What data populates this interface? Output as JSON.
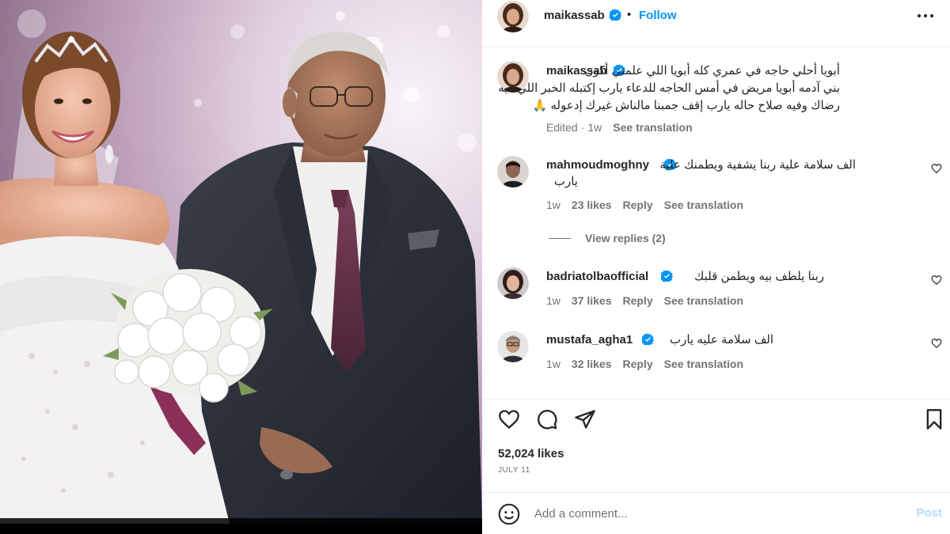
{
  "post": {
    "username": "maikassab",
    "follow_label": "Follow",
    "separator": "•",
    "caption_lines": [
      "أبويا أحلي حاجه في عمري كله أبويا اللي علمني أكون",
      "بني آدمه أبويا مريض في أمس الحاجه للدعاء يارب إكتبله الخبر اللي فيه",
      "رضاك وفيه صلاح حاله يارب إقف جمبنا مالناش غيرك إدعوله 🙏"
    ],
    "edited_label": "Edited",
    "time": "1w",
    "see_translation": "See translation",
    "likes_text": "52,024 likes",
    "date": "JULY 11"
  },
  "comments": [
    {
      "username": "mahmoudmoghny",
      "text_lines": [
        "الف سلامة علية ربنا يشفية ويطمنك علية",
        "يارب"
      ],
      "time": "1w",
      "likes": "23 likes",
      "reply": "Reply",
      "see_translation": "See translation",
      "view_replies": "View replies (2)"
    },
    {
      "username": "badriatolbaofficial",
      "text_lines": [
        "ربنا يلطف بيه ويطمن قلبك"
      ],
      "time": "1w",
      "likes": "37 likes",
      "reply": "Reply",
      "see_translation": "See translation"
    },
    {
      "username": "mustafa_agha1",
      "text_lines": [
        "الف سلامة عليه يارب"
      ],
      "time": "1w",
      "likes": "32 likes",
      "reply": "Reply",
      "see_translation": "See translation"
    }
  ],
  "composer": {
    "placeholder": "Add a comment...",
    "post_label": "Post"
  },
  "icons": {
    "verified": "verified-badge-icon",
    "more": "more-options-icon",
    "like": "heart-icon",
    "comment": "comment-icon",
    "share": "share-icon",
    "save": "bookmark-icon",
    "emoji": "emoji-icon"
  },
  "colors": {
    "accent": "#0095f6",
    "verified": "#0095f6",
    "muted": "#737373",
    "text": "#262626",
    "post_disabled": "#b3dbff"
  }
}
